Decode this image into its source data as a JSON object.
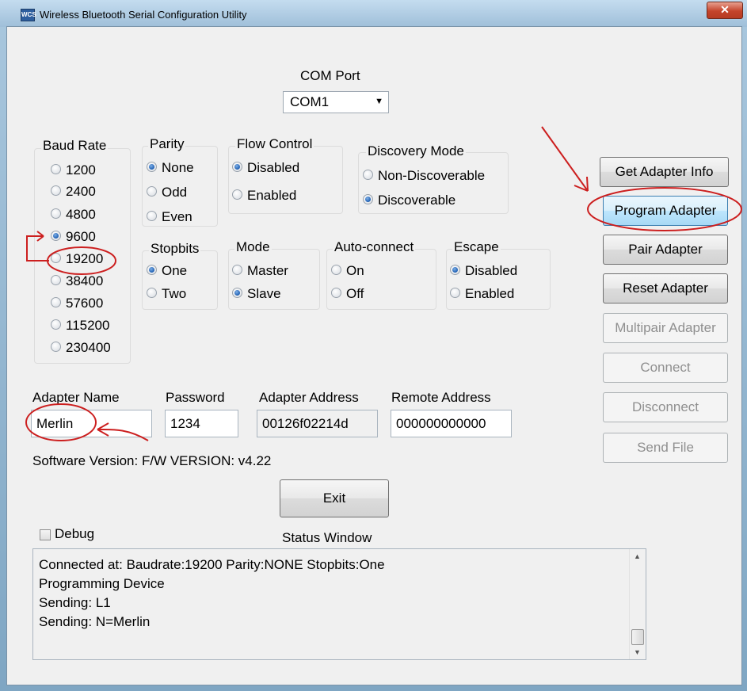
{
  "window": {
    "title": "Wireless Bluetooth Serial Configuration Utility",
    "icon_text": "WCS",
    "close_glyph": "✕"
  },
  "com_port": {
    "label": "COM Port",
    "value": "COM1",
    "arrow": "▼"
  },
  "baud_rate": {
    "label": "Baud Rate",
    "options": [
      "1200",
      "2400",
      "4800",
      "9600",
      "19200",
      "38400",
      "57600",
      "115200",
      "230400"
    ],
    "selected": "9600"
  },
  "parity": {
    "label": "Parity",
    "options": [
      "None",
      "Odd",
      "Even"
    ],
    "selected": "None"
  },
  "flow_control": {
    "label": "Flow Control",
    "options": [
      "Disabled",
      "Enabled"
    ],
    "selected": "Disabled"
  },
  "discovery_mode": {
    "label": "Discovery Mode",
    "options": [
      "Non-Discoverable",
      "Discoverable"
    ],
    "selected": "Discoverable"
  },
  "stopbits": {
    "label": "Stopbits",
    "options": [
      "One",
      "Two"
    ],
    "selected": "One"
  },
  "mode": {
    "label": "Mode",
    "options": [
      "Master",
      "Slave"
    ],
    "selected": "Slave"
  },
  "auto_connect": {
    "label": "Auto-connect",
    "options": [
      "On",
      "Off"
    ],
    "selected": null
  },
  "escape": {
    "label": "Escape",
    "options": [
      "Disabled",
      "Enabled"
    ],
    "selected": "Disabled"
  },
  "fields": {
    "adapter_name": {
      "label": "Adapter Name",
      "value": "Merlin"
    },
    "password": {
      "label": "Password",
      "value": "1234"
    },
    "adapter_address": {
      "label": "Adapter Address",
      "value": "00126f02214d"
    },
    "remote_address": {
      "label": "Remote Address",
      "value": "000000000000"
    }
  },
  "software_version": "Software Version: F/W VERSION: v4.22",
  "buttons": {
    "get_info": "Get Adapter Info",
    "program": "Program Adapter",
    "pair": "Pair Adapter",
    "reset": "Reset Adapter",
    "multipair": "Multipair Adapter",
    "connect": "Connect",
    "disconnect": "Disconnect",
    "send_file": "Send File",
    "exit": "Exit"
  },
  "debug_label": "Debug",
  "status": {
    "title": "Status Window",
    "lines": [
      "Connected at: Baudrate:19200 Parity:NONE Stopbits:One",
      "Programming Device",
      "Sending: L1",
      "Sending: N=Merlin"
    ],
    "scroll_up": "▲",
    "scroll_down": "▼"
  },
  "colors": {
    "annotation": "#cc1f1f",
    "focus_border": "#3c7fb1"
  }
}
